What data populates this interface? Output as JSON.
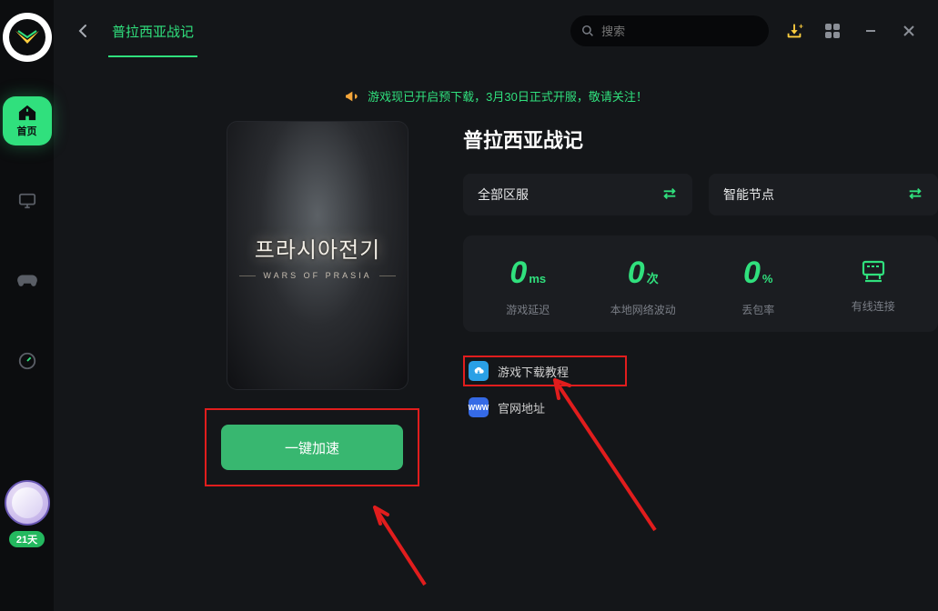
{
  "sidebar": {
    "home_label": "首页",
    "days_badge": "21天"
  },
  "topbar": {
    "game_tab": "普拉西亚战记",
    "search_placeholder": "搜索"
  },
  "banner": {
    "text": "游戏现已开启预下载，3月30日正式开服，敬请关注！"
  },
  "game": {
    "cover_title": "프라시아전기",
    "cover_sub": "WARS OF PRASIA",
    "title": "普拉西亚战记",
    "region_selector": "全部区服",
    "node_selector": "智能节点"
  },
  "stats": {
    "latency_val": "0",
    "latency_unit": "ms",
    "latency_label": "游戏延迟",
    "jitter_val": "0",
    "jitter_unit": "次",
    "jitter_label": "本地网络波动",
    "loss_val": "0",
    "loss_unit": "%",
    "loss_label": "丢包率",
    "conn_label": "有线连接"
  },
  "links": {
    "download_tutorial": "游戏下载教程",
    "official_site": "官网地址"
  },
  "actions": {
    "boost": "一键加速"
  }
}
